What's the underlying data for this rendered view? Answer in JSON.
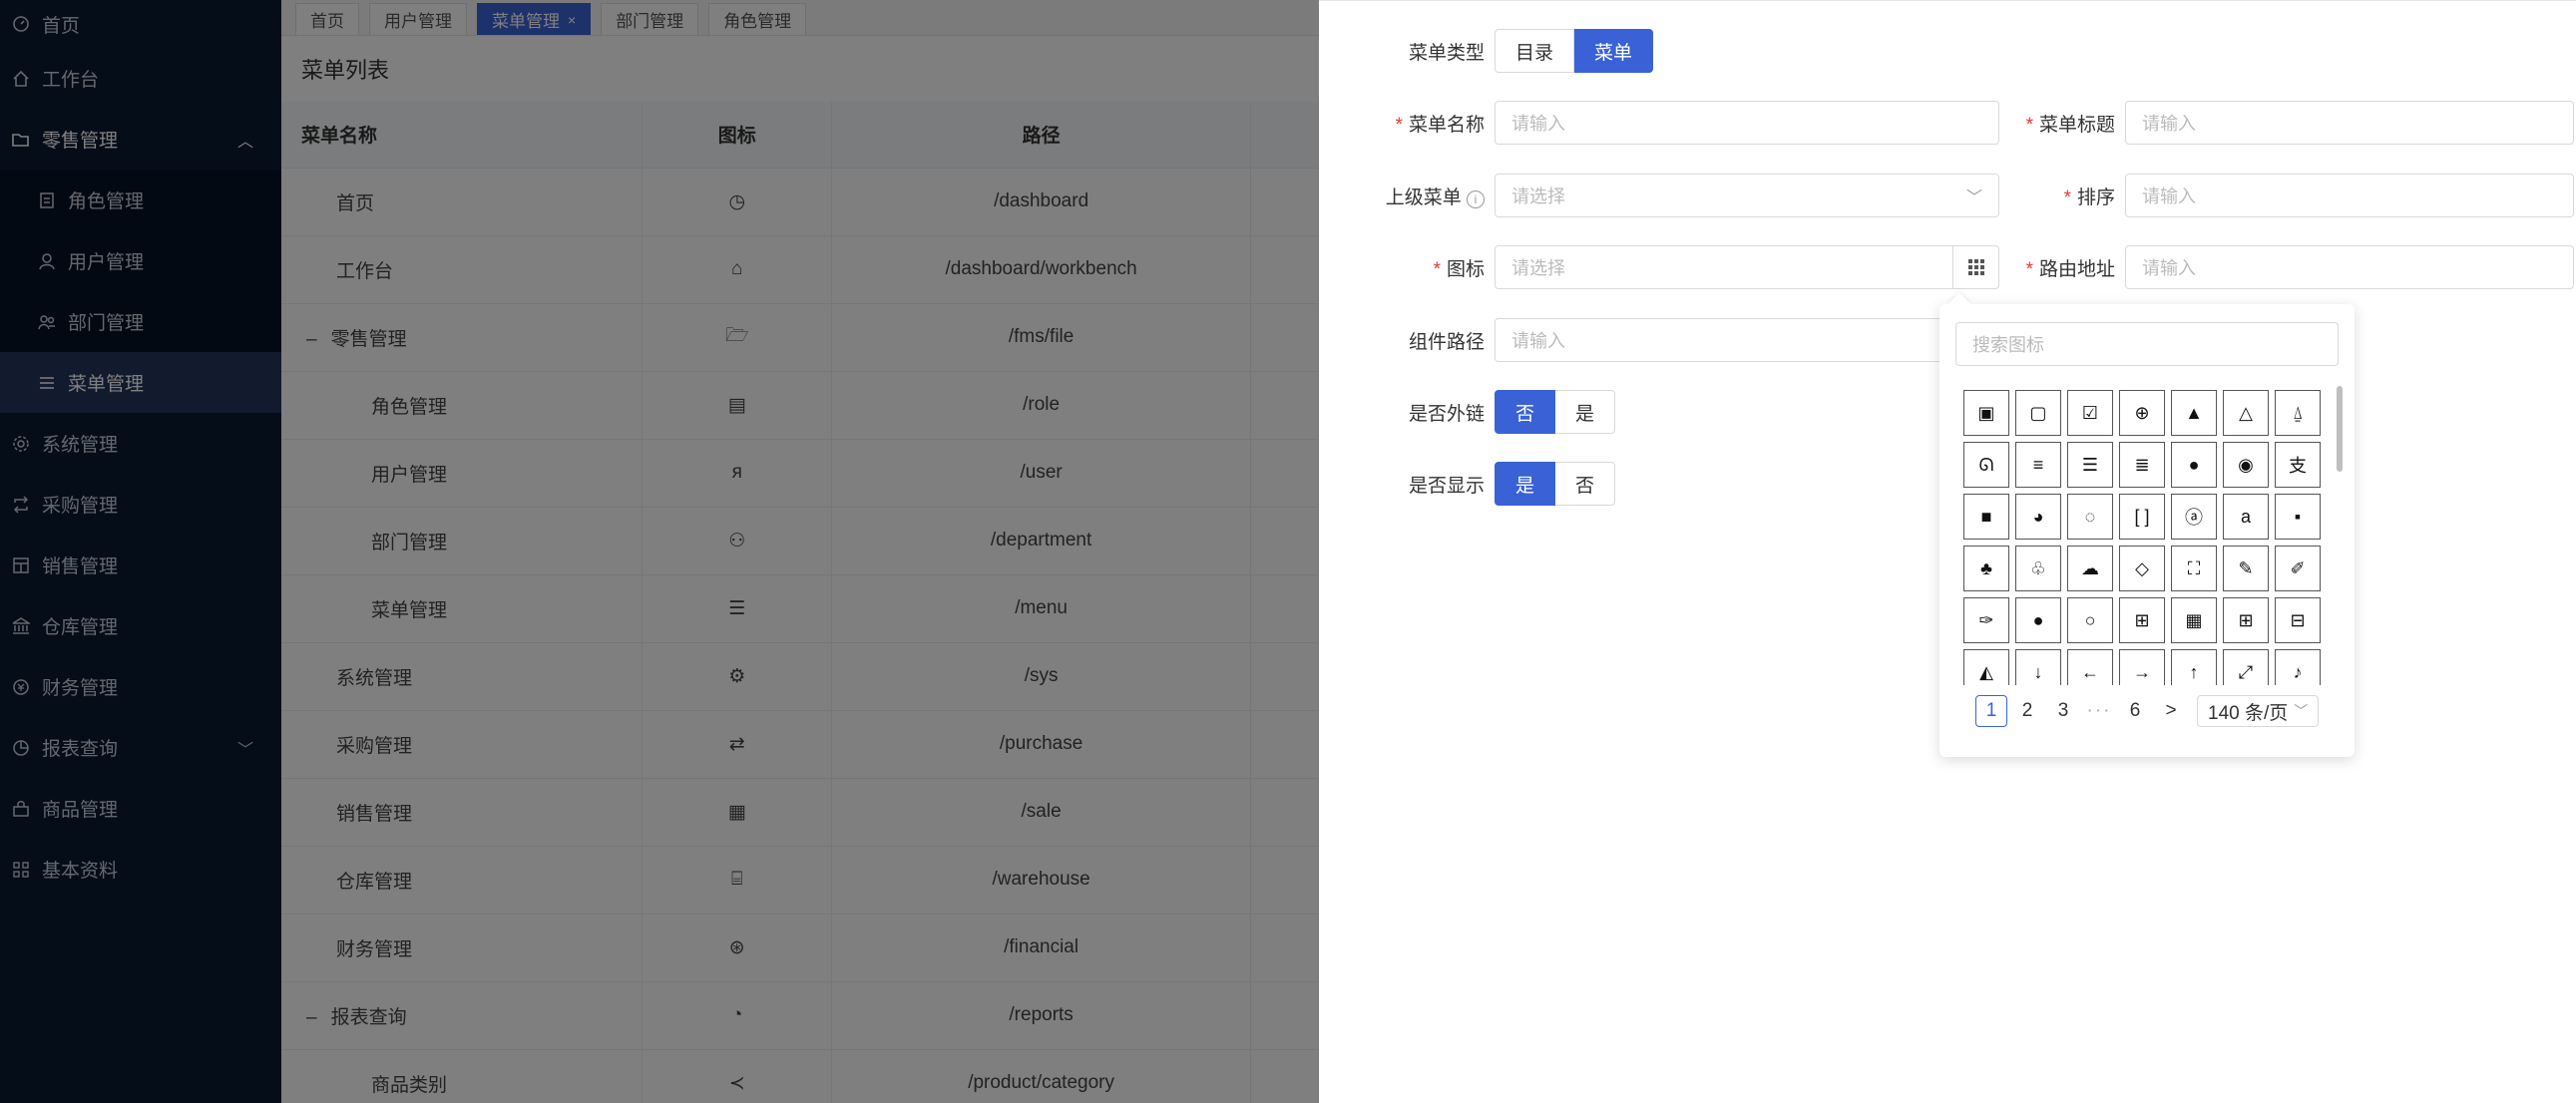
{
  "sidebar": {
    "items": [
      {
        "label": "首页",
        "icon": "dashboard-icon"
      },
      {
        "label": "工作台",
        "icon": "home-icon"
      },
      {
        "label": "零售管理",
        "icon": "folder-icon"
      },
      {
        "label": "角色管理",
        "icon": "role-icon"
      },
      {
        "label": "用户管理",
        "icon": "user-icon"
      },
      {
        "label": "部门管理",
        "icon": "department-icon"
      },
      {
        "label": "菜单管理",
        "icon": "menu-icon"
      },
      {
        "label": "系统管理",
        "icon": "gear-icon"
      },
      {
        "label": "采购管理",
        "icon": "repeat-icon"
      },
      {
        "label": "销售管理",
        "icon": "sale-icon"
      },
      {
        "label": "仓库管理",
        "icon": "bank-icon"
      },
      {
        "label": "财务管理",
        "icon": "finance-icon"
      },
      {
        "label": "报表查询",
        "icon": "pie-icon"
      },
      {
        "label": "商品管理",
        "icon": "shop-icon"
      },
      {
        "label": "基本资料",
        "icon": "apps-icon"
      }
    ]
  },
  "tabs": [
    {
      "label": "首页"
    },
    {
      "label": "用户管理"
    },
    {
      "label": "菜单管理",
      "close": "×"
    },
    {
      "label": "部门管理"
    },
    {
      "label": "角色管理"
    }
  ],
  "table": {
    "title": "菜单列表",
    "headers": {
      "name": "菜单名称",
      "icon": "图标",
      "path": "路径"
    },
    "rows": [
      {
        "name": "首页",
        "path": "/dashboard"
      },
      {
        "name": "工作台",
        "path": "/dashboard/workbench"
      },
      {
        "name": "零售管理",
        "path": "/fms/file",
        "toggle": "–"
      },
      {
        "name": "角色管理",
        "path": "/role"
      },
      {
        "name": "用户管理",
        "path": "/user"
      },
      {
        "name": "部门管理",
        "path": "/department"
      },
      {
        "name": "菜单管理",
        "path": "/menu"
      },
      {
        "name": "系统管理",
        "path": "/sys"
      },
      {
        "name": "采购管理",
        "path": "/purchase"
      },
      {
        "name": "销售管理",
        "path": "/sale"
      },
      {
        "name": "仓库管理",
        "path": "/warehouse"
      },
      {
        "name": "财务管理",
        "path": "/financial"
      },
      {
        "name": "报表查询",
        "path": "/reports",
        "toggle": "–"
      },
      {
        "name": "商品类别",
        "path": "/product/category"
      }
    ]
  },
  "form": {
    "menu_type": {
      "label": "菜单类型",
      "options": [
        "目录",
        "菜单"
      ],
      "selected": "菜单"
    },
    "menu_name": {
      "label": "菜单名称",
      "placeholder": "请输入"
    },
    "menu_title": {
      "label": "菜单标题",
      "placeholder": "请输入"
    },
    "parent_menu": {
      "label": "上级菜单",
      "placeholder": "请选择"
    },
    "sort": {
      "label": "排序",
      "placeholder": "请输入"
    },
    "icon": {
      "label": "图标",
      "placeholder": "请选择"
    },
    "route": {
      "label": "路由地址",
      "placeholder": "请输入"
    },
    "component": {
      "label": "组件路径",
      "placeholder": "请输入"
    },
    "external": {
      "label": "是否外链",
      "options": [
        "否",
        "是"
      ],
      "selected": "否"
    },
    "visible": {
      "label": "是否显示",
      "options": [
        "是",
        "否"
      ],
      "selected": "是"
    },
    "required_mark": "*"
  },
  "icon_picker": {
    "search_placeholder": "搜索图标",
    "pages": [
      "1",
      "2",
      "3",
      "···",
      "6",
      ">"
    ],
    "current_page": "1",
    "page_size": "140 条/页"
  },
  "colors": {
    "sidebar_bg": "#0b1a33",
    "accent": "#3a62d6",
    "required": "#e53935"
  }
}
